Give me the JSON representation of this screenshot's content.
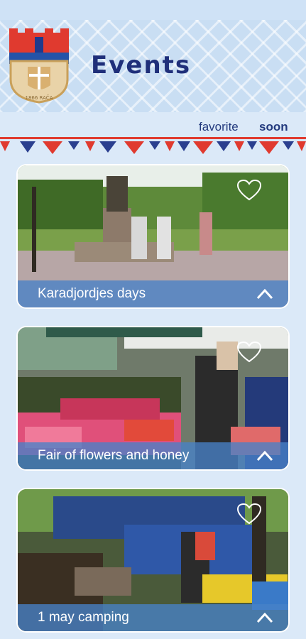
{
  "header": {
    "title": "Events",
    "crest_text": "1866 RAČA",
    "colors": {
      "crest_red": "#e03a2f",
      "crest_blue": "#2453a8",
      "crest_gold": "#d9b070",
      "title": "#1f2f7a"
    }
  },
  "tabs": [
    {
      "label": "favorite",
      "active": false
    },
    {
      "label": "soon",
      "active": true
    }
  ],
  "events": [
    {
      "title": "Karadjordjes days",
      "favorite": false,
      "icon": "heart-outline-icon"
    },
    {
      "title": "Fair of flowers and honey",
      "favorite": false,
      "icon": "heart-outline-icon"
    },
    {
      "title": "1 may camping",
      "favorite": false,
      "icon": "heart-outline-icon"
    }
  ]
}
